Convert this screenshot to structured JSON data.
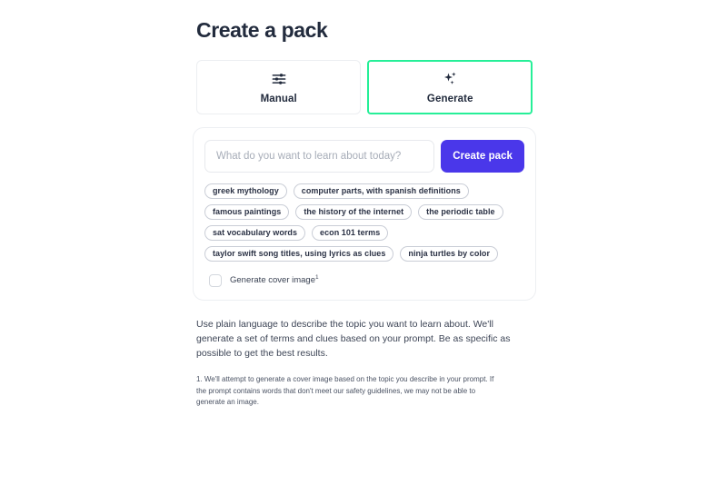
{
  "page": {
    "title": "Create a pack"
  },
  "tabs": [
    {
      "id": "manual",
      "label": "Manual",
      "icon": "sliders-icon",
      "active": false
    },
    {
      "id": "generate",
      "label": "Generate",
      "icon": "sparkles-icon",
      "active": true
    }
  ],
  "prompt": {
    "value": "",
    "placeholder": "What do you want to learn about today?",
    "submit_label": "Create pack"
  },
  "suggestions": [
    "greek mythology",
    "computer parts, with spanish definitions",
    "famous paintings",
    "the history of the internet",
    "the periodic table",
    "sat vocabulary words",
    "econ 101 terms",
    "taylor swift song titles, using lyrics as clues",
    "ninja turtles by color"
  ],
  "cover_image": {
    "label": "Generate cover image",
    "footnote_marker": "1",
    "checked": false
  },
  "helper_text": "Use plain language to describe the topic you want to learn about. We'll generate a set of terms and clues based on your prompt. Be as specific as possible to get the best results.",
  "footnote_text": "1. We'll attempt to generate a cover image based on the topic you describe in your prompt. If the prompt contains words that don't meet our safety guidelines, we may not be able to generate an image.",
  "colors": {
    "accent_green": "#26ef98",
    "button_indigo": "#4a37ea",
    "text_dark": "#222b3d",
    "border_light": "#edeff2",
    "placeholder": "#a7adb8",
    "background": "#ffffff"
  }
}
